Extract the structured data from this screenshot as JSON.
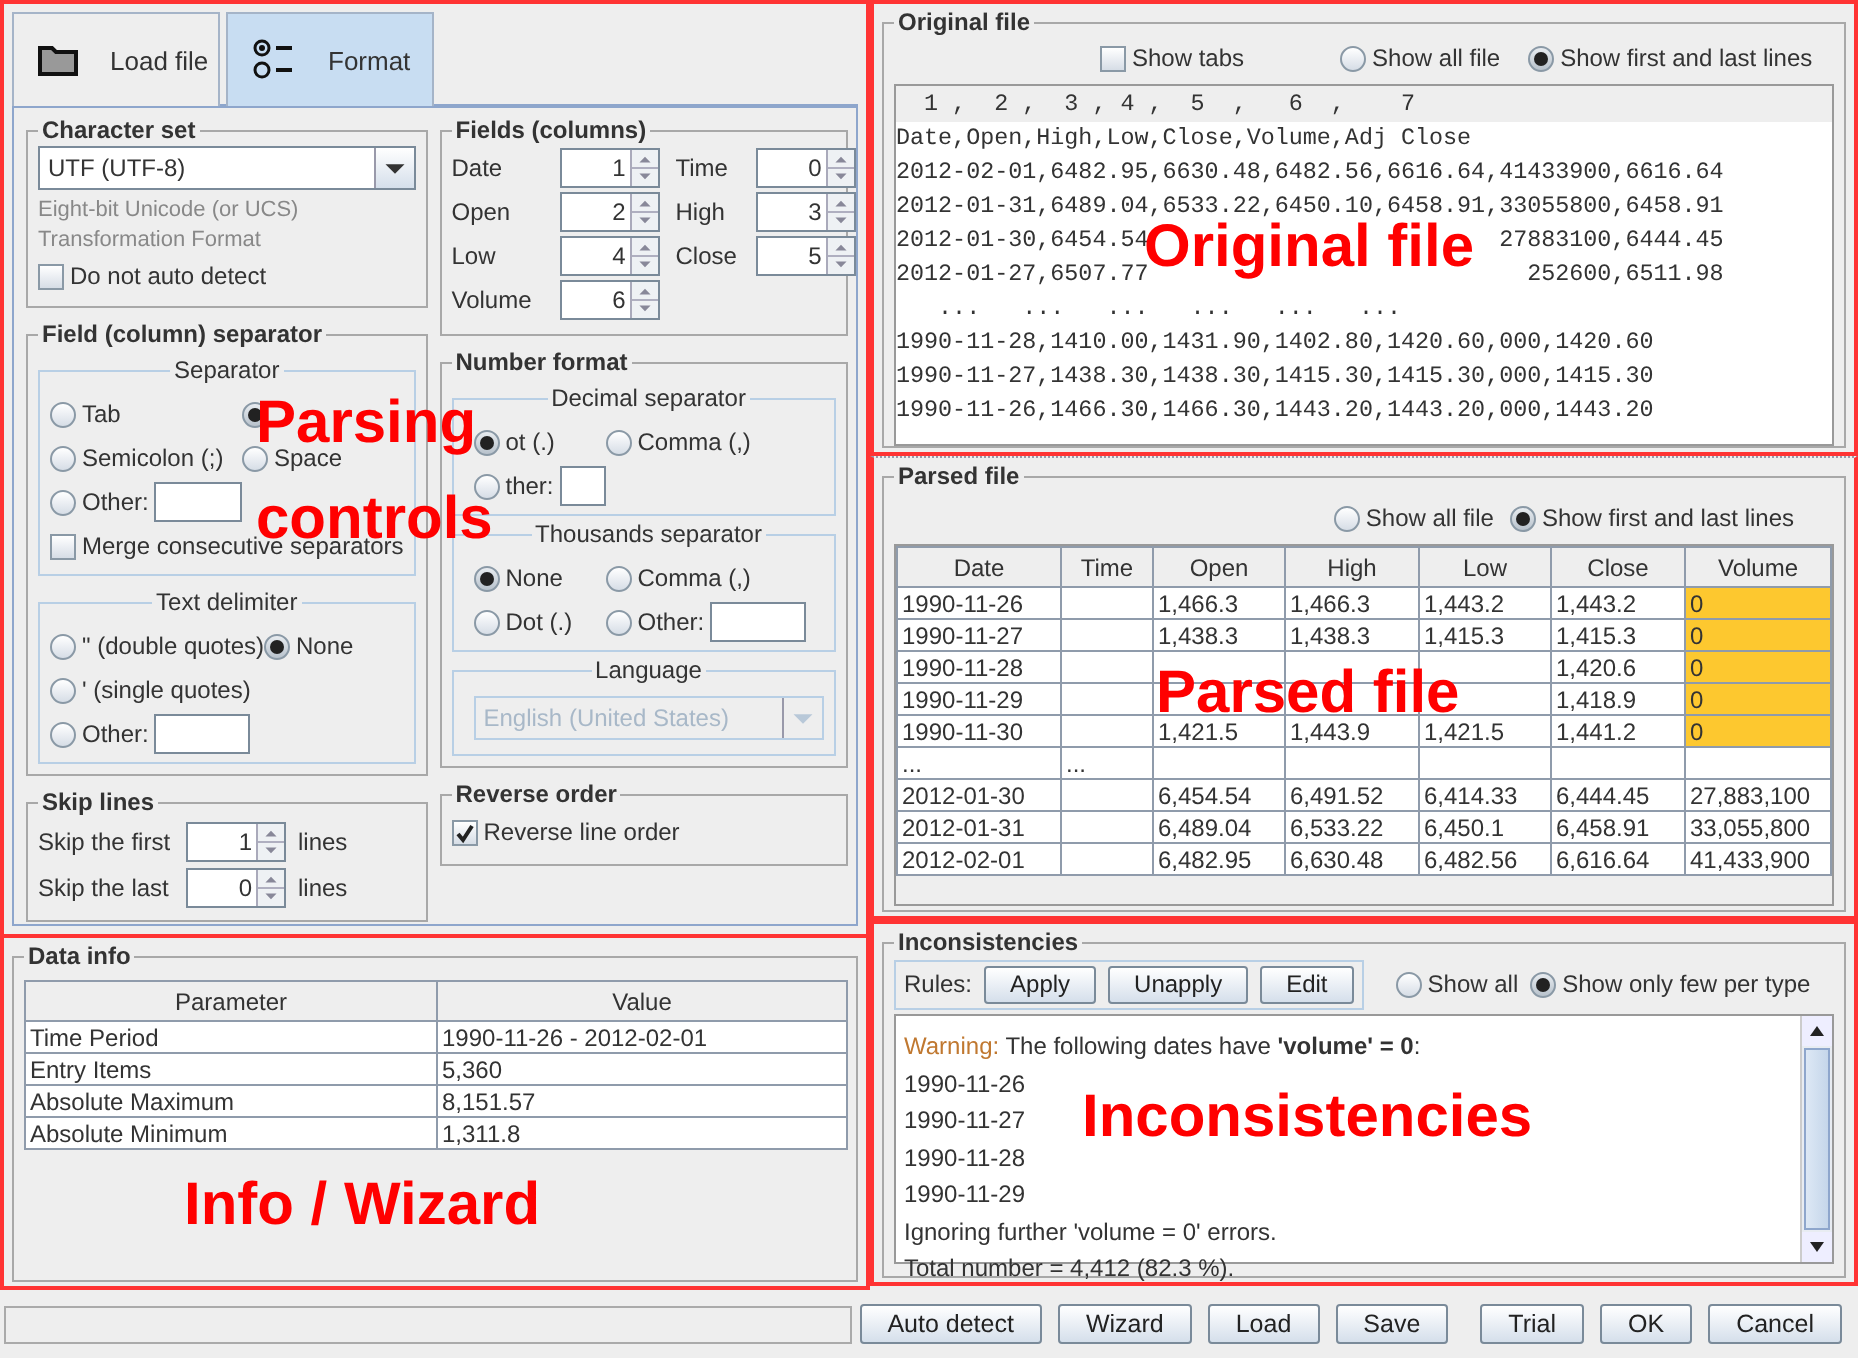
{
  "tabs": [
    {
      "label": "Load file",
      "kind": "folder",
      "selected": false
    },
    {
      "label": "Format",
      "kind": "options",
      "selected": true
    }
  ],
  "character_set": {
    "title": "Character set",
    "value": "UTF (UTF-8)",
    "description": "Eight-bit Unicode (or UCS) Transformation Format",
    "auto_detect": {
      "label": "Do not auto detect",
      "checked": false
    }
  },
  "fields": {
    "title": "Fields (columns)",
    "items": [
      {
        "label": "Date",
        "value": "1"
      },
      {
        "label": "Time",
        "value": "0"
      },
      {
        "label": "Open",
        "value": "2"
      },
      {
        "label": "High",
        "value": "3"
      },
      {
        "label": "Low",
        "value": "4"
      },
      {
        "label": "Close",
        "value": "5"
      },
      {
        "label": "Volume",
        "value": "6"
      }
    ]
  },
  "field_separator": {
    "title": "Field (column) separator",
    "separator": {
      "title": "Separator",
      "rows": [
        [
          {
            "label": "Tab",
            "kind": "plain",
            "selected": false
          },
          {
            "kind": "plain",
            "selected": true
          }
        ],
        [
          {
            "label": "Semicolon (;)",
            "kind": "plain",
            "selected": false
          },
          {
            "label": "Space",
            "kind": "plain",
            "selected": false
          }
        ],
        [
          {
            "label": "Other:",
            "kind": "other",
            "selected": false
          }
        ]
      ],
      "merge": {
        "label": "Merge consecutive separators",
        "checked": false
      }
    },
    "text_delimiter": {
      "title": "Text delimiter",
      "rows": [
        [
          {
            "label": "\" (double quotes)",
            "kind": "plain",
            "selected": false
          },
          {
            "label": "None",
            "kind": "plain",
            "selected": true
          }
        ],
        [
          {
            "label": "' (single quotes)",
            "kind": "plain",
            "selected": false
          }
        ],
        [
          {
            "label": "Other:",
            "kind": "other",
            "selected": false
          }
        ]
      ]
    }
  },
  "number_format": {
    "title": "Number format",
    "decimal": {
      "title": "Decimal separator",
      "rows": [
        [
          {
            "label": "ot (.)",
            "kind": "plain",
            "selected": true
          },
          {
            "label": "Comma (,)",
            "kind": "plain",
            "selected": false
          }
        ],
        [
          {
            "label": "ther:",
            "kind": "other",
            "selected": false
          }
        ]
      ]
    },
    "thousands": {
      "title": "Thousands separator",
      "rows": [
        [
          {
            "label": "None",
            "kind": "plain",
            "selected": true
          },
          {
            "label": "Comma (,)",
            "kind": "plain",
            "selected": false
          }
        ],
        [
          {
            "label": "Dot (.)",
            "kind": "plain",
            "selected": false
          },
          {
            "label": "Other:",
            "kind": "other",
            "selected": false
          }
        ]
      ]
    },
    "language": {
      "title": "Language",
      "value": "English (United States)",
      "disabled": true
    }
  },
  "skip_lines": {
    "title": "Skip lines",
    "items": [
      {
        "label": "Skip the first",
        "value": "1",
        "unit": "lines"
      },
      {
        "label": "Skip the last",
        "value": "0",
        "unit": "lines"
      }
    ]
  },
  "reverse_order": {
    "title": "Reverse order",
    "label": "Reverse line order",
    "checked": true
  },
  "original_file": {
    "title": "Original file",
    "show_tabs": {
      "label": "Show tabs",
      "checked": false
    },
    "view_options": [
      {
        "label": "Show all file",
        "selected": false
      },
      {
        "label": "Show first and last lines",
        "selected": true
      }
    ],
    "ruler": "  1 ,  2 ,  3 , 4 ,  5  ,   6  ,    7",
    "lines": [
      [
        "Date,Open,High,Low,Close,Volume,Adj Close"
      ],
      [
        "2012-02-01,6482.95,6630.48,6482.56,6616.64,41433900,6616.64"
      ],
      [
        "2012-01-31,6489.04,6533.22,6450.10,6458.91,33055800,6458.91"
      ],
      [
        "2012-01-30,6454.54",
        "27883100,6444.45"
      ],
      [
        "2012-01-27,6507.77",
        "252600,6511.98"
      ],
      [
        "   ...   ...   ...   ...   ...   ..."
      ],
      [
        "1990-11-28,1410.00,1431.90,1402.80,1420.60,000,1420.60"
      ],
      [
        "1990-11-27,1438.30,1438.30,1415.30,1415.30,000,1415.30"
      ],
      [
        "1990-11-26,1466.30,1466.30,1443.20,1443.20,000,1443.20"
      ]
    ]
  },
  "parsed_file": {
    "title": "Parsed file",
    "view_options": [
      {
        "label": "Show all file",
        "selected": false
      },
      {
        "label": "Show first and last lines",
        "selected": true
      }
    ],
    "columns": [
      "Date",
      "Time",
      "Open",
      "High",
      "Low",
      "Close",
      "Volume"
    ],
    "rows": [
      {
        "cells": [
          "1990-11-26",
          null,
          "1,466.3",
          "1,466.3",
          "1,443.2",
          "1,443.2",
          "0"
        ],
        "flagged": true
      },
      {
        "cells": [
          "1990-11-27",
          null,
          "1,438.3",
          "1,438.3",
          "1,415.3",
          "1,415.3",
          "0"
        ],
        "flagged": true
      },
      {
        "cells": [
          "1990-11-28",
          null,
          null,
          null,
          null,
          "1,420.6",
          "0"
        ],
        "flagged": true
      },
      {
        "cells": [
          "1990-11-29",
          null,
          null,
          null,
          null,
          "1,418.9",
          "0"
        ],
        "flagged": true
      },
      {
        "cells": [
          "1990-11-30",
          null,
          "1,421.5",
          "1,443.9",
          "1,421.5",
          "1,441.2",
          "0"
        ],
        "flagged": true
      },
      {
        "cells": [
          "...",
          "...",
          null,
          null,
          null,
          null,
          null
        ],
        "flagged": false
      },
      {
        "cells": [
          "2012-01-30",
          null,
          "6,454.54",
          "6,491.52",
          "6,414.33",
          "6,444.45",
          "27,883,100"
        ],
        "flagged": false
      },
      {
        "cells": [
          "2012-01-31",
          null,
          "6,489.04",
          "6,533.22",
          "6,450.1",
          "6,458.91",
          "33,055,800"
        ],
        "flagged": false
      },
      {
        "cells": [
          "2012-02-01",
          null,
          "6,482.95",
          "6,630.48",
          "6,482.56",
          "6,616.64",
          "41,433,900"
        ],
        "flagged": false
      }
    ]
  },
  "data_info": {
    "title": "Data info",
    "columns": [
      "Parameter",
      "Value"
    ],
    "rows": [
      [
        "Time Period",
        "1990-11-26 - 2012-02-01"
      ],
      [
        "Entry Items",
        "5,360"
      ],
      [
        "Absolute Maximum",
        "8,151.57"
      ],
      [
        "Absolute Minimum",
        "1,311.8"
      ]
    ]
  },
  "inconsistencies": {
    "title": "Inconsistencies",
    "rules_label": "Rules:",
    "buttons": [
      "Apply",
      "Unapply",
      "Edit"
    ],
    "view_options": [
      {
        "label": "Show all",
        "selected": false
      },
      {
        "label": "Show only few per type",
        "selected": true
      }
    ],
    "messages": [
      {
        "kind": "warning",
        "prefix": "Warning:",
        "text": "The following dates have **'volume' = 0**:"
      },
      {
        "kind": "plain",
        "text": "1990-11-26"
      },
      {
        "kind": "plain",
        "text": "1990-11-27"
      },
      {
        "kind": "plain",
        "text": "1990-11-28"
      },
      {
        "kind": "plain",
        "text": "1990-11-29"
      },
      {
        "kind": "plain",
        "text": "Ignoring further 'volume = 0' errors."
      },
      {
        "kind": "plain",
        "text": "Total number = 4,412 (82.3 %)."
      }
    ]
  },
  "buttons": [
    "Auto detect",
    "Wizard",
    "Load",
    "Save",
    "Trial",
    "OK",
    "Cancel"
  ],
  "annotations": [
    "Parsing",
    "controls",
    "Original file",
    "Parsed file",
    "Info / Wizard",
    "Inconsistencies"
  ]
}
